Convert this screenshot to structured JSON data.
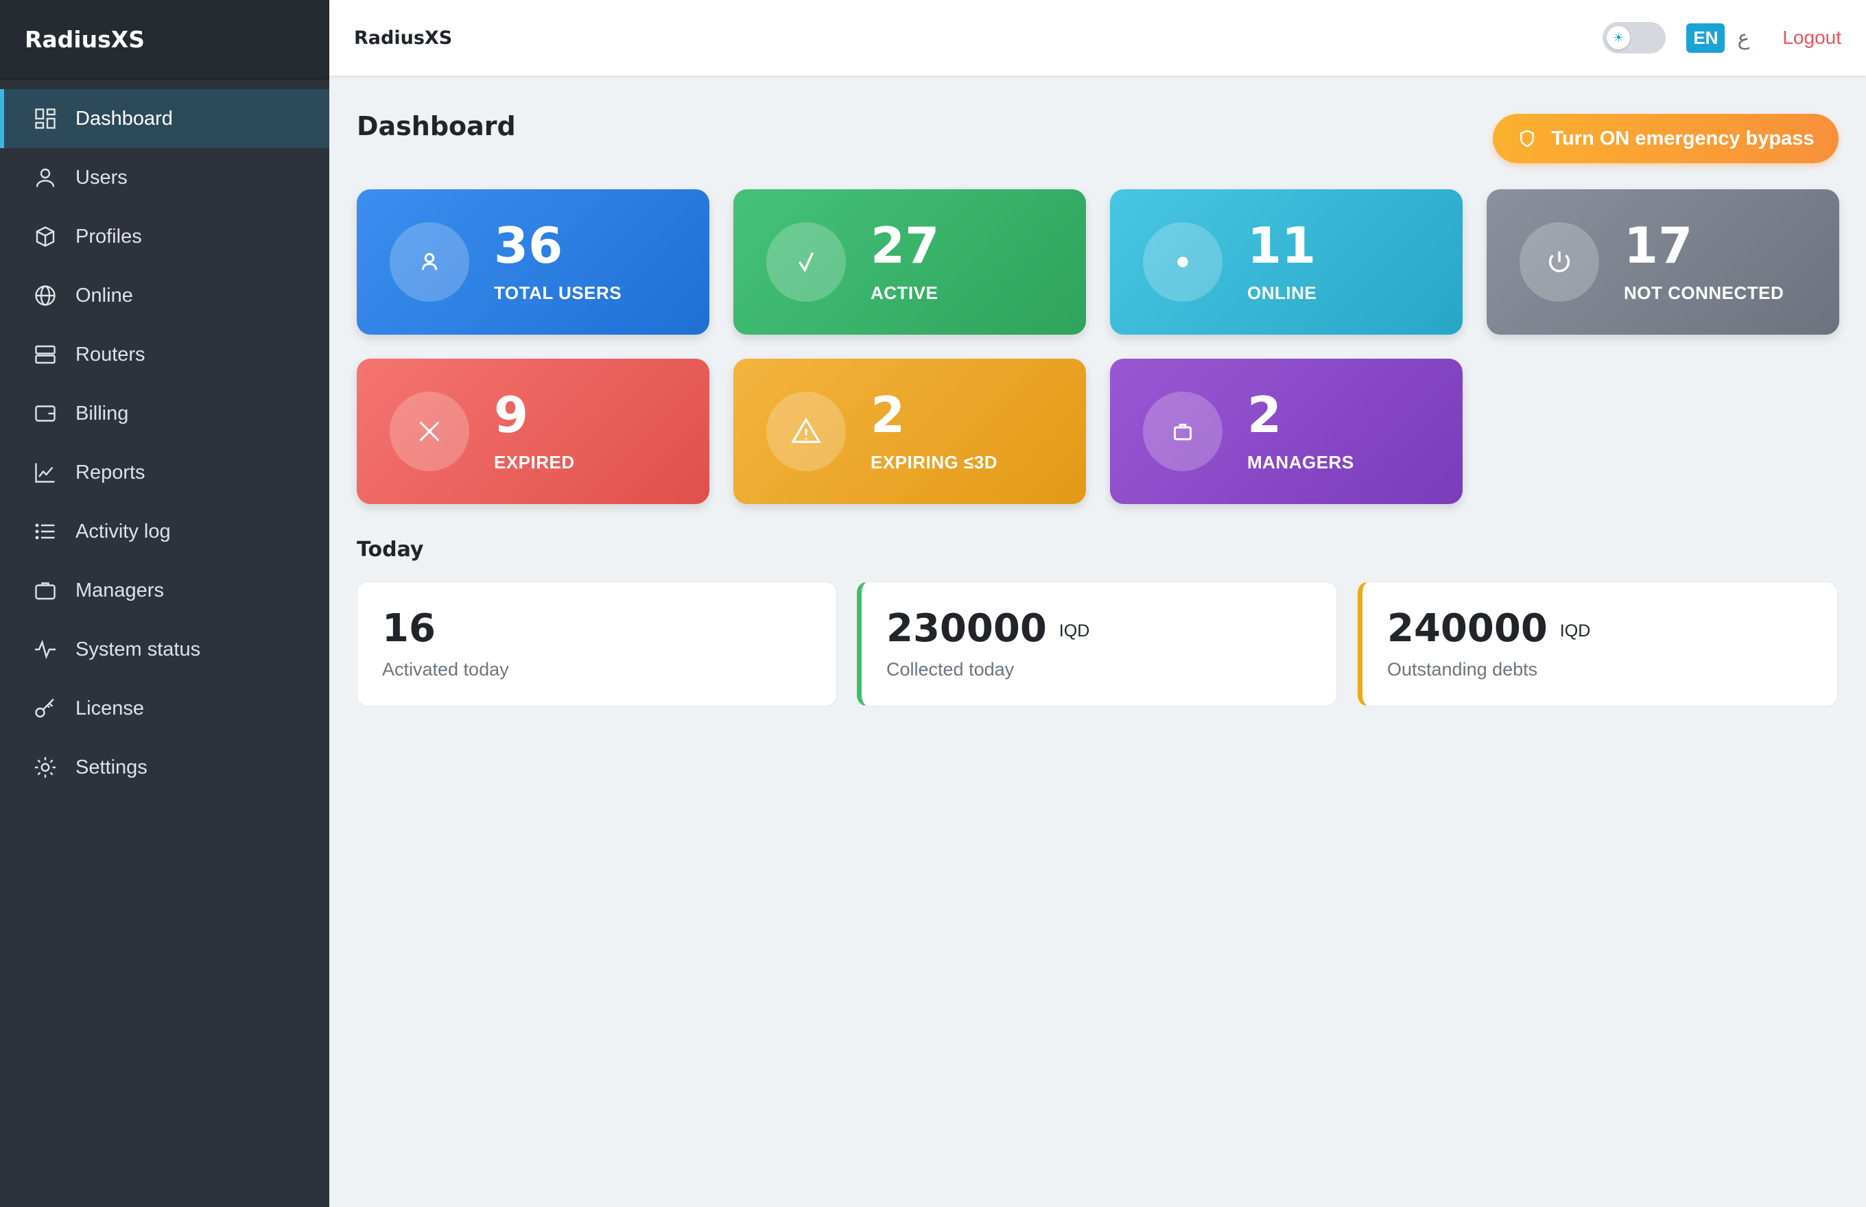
{
  "app": {
    "brand": "RadiusXS",
    "title": "RadiusXS"
  },
  "sidebar": {
    "items": [
      {
        "label": "Dashboard",
        "icon": "dashboard-icon",
        "active": true
      },
      {
        "label": "Users",
        "icon": "user-icon"
      },
      {
        "label": "Profiles",
        "icon": "box-icon"
      },
      {
        "label": "Online",
        "icon": "globe-icon"
      },
      {
        "label": "Routers",
        "icon": "server-icon"
      },
      {
        "label": "Billing",
        "icon": "wallet-icon"
      },
      {
        "label": "Reports",
        "icon": "chart-line-icon"
      },
      {
        "label": "Activity log",
        "icon": "list-icon"
      },
      {
        "label": "Managers",
        "icon": "briefcase-icon"
      },
      {
        "label": "System status",
        "icon": "pulse-icon"
      },
      {
        "label": "License",
        "icon": "key-icon"
      },
      {
        "label": "Settings",
        "icon": "gear-icon"
      }
    ]
  },
  "topbar": {
    "theme_toggle_icon": "sun-icon",
    "lang_en": "EN",
    "lang_ar": "ع",
    "logout": "Logout"
  },
  "main": {
    "page_title": "Dashboard",
    "bypass_button": "Turn ON emergency bypass",
    "stats": [
      {
        "value": "36",
        "label": "TOTAL USERS",
        "icon": "user-icon",
        "color_from": "#3b8ff0",
        "color_to": "#1f6fd4"
      },
      {
        "value": "27",
        "label": "ACTIVE",
        "icon": "check-icon",
        "color_from": "#45c27a",
        "color_to": "#2ea35c"
      },
      {
        "value": "11",
        "label": "ONLINE",
        "icon": "dot-icon",
        "color_from": "#48c6e2",
        "color_to": "#27a6c8"
      },
      {
        "value": "17",
        "label": "NOT CONNECTED",
        "icon": "power-icon",
        "color_from": "#8a919c",
        "color_to": "#6c737e"
      },
      {
        "value": "9",
        "label": "EXPIRED",
        "icon": "x-icon",
        "color_from": "#f57470",
        "color_to": "#e0504a"
      },
      {
        "value": "2",
        "label": "EXPIRING ≤3D",
        "icon": "warning-icon",
        "color_from": "#f4b43e",
        "color_to": "#e39916"
      },
      {
        "value": "2",
        "label": "MANAGERS",
        "icon": "briefcase-icon",
        "color_from": "#9a57d3",
        "color_to": "#7a3cba"
      }
    ],
    "today_title": "Today",
    "today": [
      {
        "value": "16",
        "unit": "",
        "label": "Activated today"
      },
      {
        "value": "230000",
        "unit": "IQD",
        "label": "Collected today"
      },
      {
        "value": "240000",
        "unit": "IQD",
        "label": "Outstanding debts"
      }
    ]
  }
}
